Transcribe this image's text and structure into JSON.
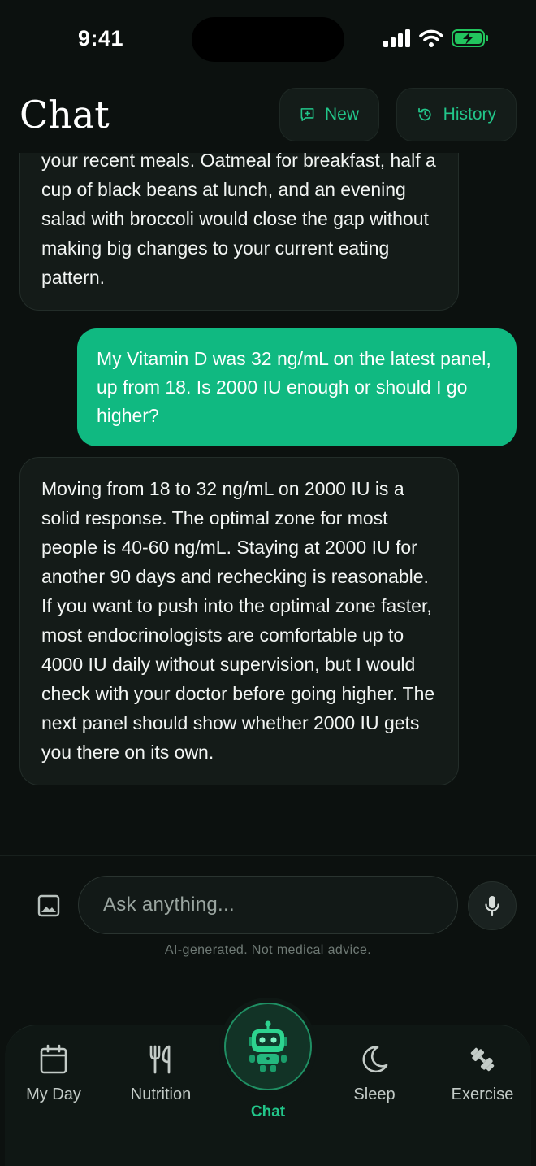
{
  "status_bar": {
    "time": "9:41"
  },
  "header": {
    "title": "Chat",
    "new_label": "New",
    "history_label": "History"
  },
  "messages": [
    {
      "role": "assistant",
      "text": "your recent meals. Oatmeal for breakfast, half a cup of black beans at lunch, and an evening salad with broccoli would close the gap without making big changes to your current eating pattern."
    },
    {
      "role": "user",
      "text": "My Vitamin D was 32 ng/mL on the latest panel, up from 18. Is 2000 IU enough or should I go higher?"
    },
    {
      "role": "assistant",
      "text": "Moving from 18 to 32 ng/mL on 2000 IU is a solid response. The optimal zone for most people is 40-60 ng/mL. Staying at 2000 IU for another 90 days and rechecking is reasonable. If you want to push into the optimal zone faster, most endocrinologists are comfortable up to 4000 IU daily without supervision, but I would check with your doctor before going higher. The next panel should show whether 2000 IU gets you there on its own."
    }
  ],
  "composer": {
    "placeholder": "Ask anything...",
    "value": "",
    "disclaimer": "AI-generated. Not medical advice."
  },
  "tabs": [
    {
      "key": "my_day",
      "label": "My Day",
      "icon": "calendar-icon"
    },
    {
      "key": "nutrition",
      "label": "Nutrition",
      "icon": "fork-knife-icon"
    },
    {
      "key": "chat",
      "label": "Chat",
      "icon": "robot-icon",
      "active": true
    },
    {
      "key": "sleep",
      "label": "Sleep",
      "icon": "moon-icon"
    },
    {
      "key": "exercise",
      "label": "Exercise",
      "icon": "dumbbell-icon"
    }
  ],
  "colors": {
    "accent": "#22c68a",
    "user_bubble": "#10b981",
    "background": "#0c110f",
    "assistant_bubble": "#141b18"
  },
  "battery": {
    "charging": true
  }
}
